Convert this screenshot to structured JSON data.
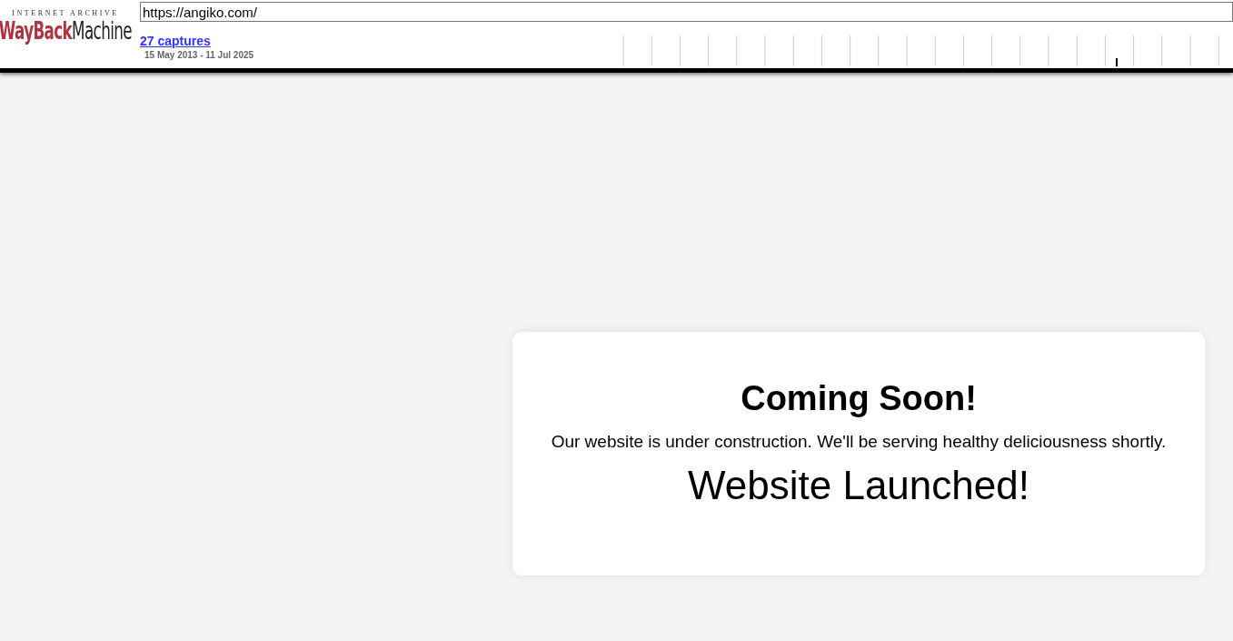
{
  "toolbar": {
    "logo": {
      "top": "INTERNET ARCHIVE",
      "brand": "WayBack",
      "product": "Machine"
    },
    "url": "https://angiko.com/",
    "captures_link": "27 captures",
    "date_range": "15 May 2013 - 11 Jul 2025"
  },
  "card": {
    "title": "Coming Soon!",
    "message": "Our website is under construction. We'll be serving healthy deliciousness shortly.",
    "status": "Website Launched!"
  }
}
